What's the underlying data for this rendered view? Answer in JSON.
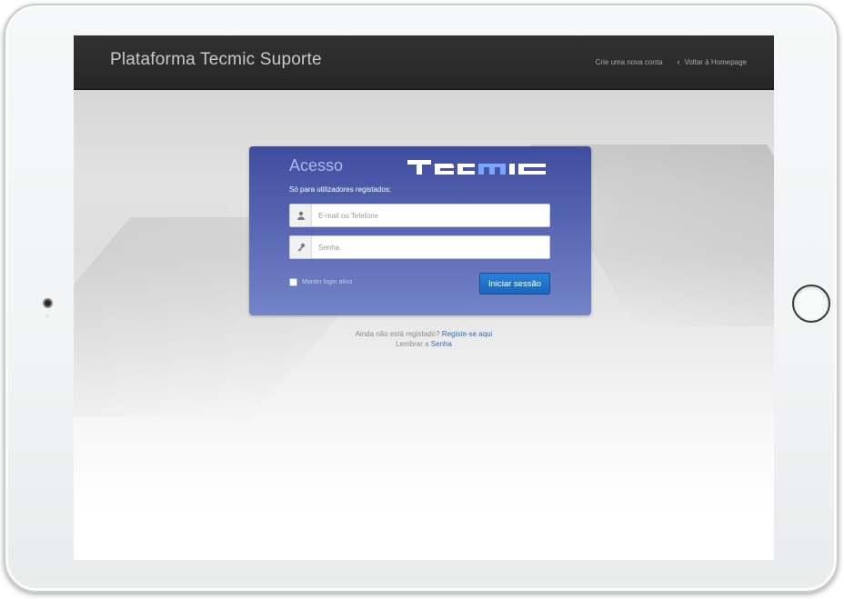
{
  "header": {
    "brand": "Plataforma Tecmic Suporte",
    "links": {
      "create_account": "Crie uma nova conta",
      "back_home": "Voltar à Homepage"
    }
  },
  "login": {
    "title": "Acesso",
    "logo_text": "tecmic",
    "subtitle": "Só para utilizadores registados:",
    "user_placeholder": "E-mail ou Telefone",
    "password_placeholder": "Senha",
    "remember_label": "Manter login ativo",
    "submit_label": "Iniciar sessão"
  },
  "footer": {
    "not_registered": "Ainda não está registado?",
    "register_link": "Registe-se aqui",
    "remember_prefix": "Lembrar a",
    "password_link": "Senha"
  },
  "colors": {
    "card_top": "#3f4d9e",
    "card_bottom": "#7484c7",
    "button": "#1a66bf",
    "link": "#2d6fb7",
    "topbar": "#2b2b2b"
  },
  "icons": {
    "user_field": "user-icon",
    "password_field": "key-icon",
    "back": "chevron-left-icon"
  }
}
